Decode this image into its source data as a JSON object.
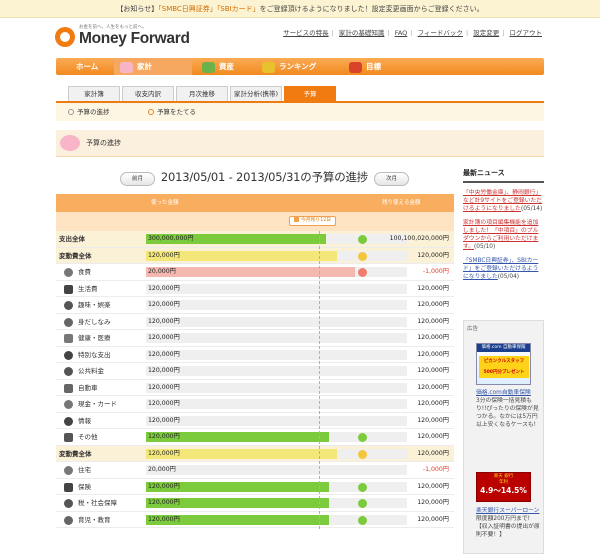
{
  "notice": {
    "prefix": "【お知らせ】",
    "b1": "「SMBC日興証券」",
    "b2": "「SBIカード」",
    "rest": "をご登録頂けるようになりました！設定変更画面からご登録ください。"
  },
  "brand": {
    "tagline": "お金を前へ。人生をもっと前へ。",
    "name": "Money Forward",
    "accent": "#f07b10"
  },
  "toplinks": [
    "サービスの特長",
    "家計の基礎知識",
    "FAQ",
    "フィードバック",
    "設定変更",
    "ログアウト"
  ],
  "gnav": [
    {
      "label": "ホーム",
      "icon": "home-icon"
    },
    {
      "label": "家計",
      "icon": "piggy-bank-icon"
    },
    {
      "label": "資産",
      "icon": "globe-icon"
    },
    {
      "label": "ランキング",
      "icon": "trophy-icon"
    },
    {
      "label": "目標",
      "icon": "goal-icon"
    }
  ],
  "subnav": [
    "家計簿",
    "収支内訳",
    "月次推移",
    "家計分析(携帯)",
    "予算"
  ],
  "subsub": [
    "予算の進捗",
    "予算をたてる"
  ],
  "section_title": "予算の進捗",
  "period": {
    "prev": "前月",
    "title": "2013/05/01 - 2013/05/31の予算の進捗",
    "next": "次月"
  },
  "table_head": {
    "used": "使った金額",
    "remaining": "残り使える金額",
    "today": "今月残り12日"
  },
  "rows": [
    {
      "label": "支出全体",
      "group": true,
      "used": "300,000,000円",
      "ratio": 0.69,
      "color": "#7ccb3c",
      "status": "good",
      "rem": "100,100,020,000円"
    },
    {
      "label": "変動費全体",
      "group": true,
      "used": "120,000円",
      "ratio": 0.73,
      "color": "#f3e77a",
      "status": "warn",
      "rem": "120,000円"
    },
    {
      "label": "食費",
      "icon": "food-icon",
      "used": "20,000円",
      "ratio": 0.8,
      "color": "#f5b8b0",
      "status": "bad",
      "rem": "-1,000円",
      "neg": true
    },
    {
      "label": "生活費",
      "icon": "smiley-icon",
      "used": "120,000円",
      "ratio": 0,
      "rem": "120,000円"
    },
    {
      "label": "趣味・娯楽",
      "icon": "star-icon",
      "used": "120,000円",
      "ratio": 0,
      "rem": "120,000円"
    },
    {
      "label": "身だしなみ",
      "icon": "shirt-icon",
      "used": "120,000円",
      "ratio": 0,
      "rem": "120,000円"
    },
    {
      "label": "健康・医療",
      "icon": "medical-icon",
      "used": "120,000円",
      "ratio": 0,
      "rem": "120,000円"
    },
    {
      "label": "特別な支出",
      "icon": "gift-icon",
      "used": "120,000円",
      "ratio": 0,
      "rem": "120,000円"
    },
    {
      "label": "公共料金",
      "icon": "bulb-icon",
      "used": "120,000円",
      "ratio": 0,
      "rem": "120,000円"
    },
    {
      "label": "自動車",
      "icon": "car-icon",
      "used": "120,000円",
      "ratio": 0,
      "rem": "120,000円"
    },
    {
      "label": "現金・カード",
      "icon": "card-icon",
      "used": "120,000円",
      "ratio": 0,
      "rem": "120,000円"
    },
    {
      "label": "情報",
      "icon": "info-icon",
      "used": "120,000円",
      "ratio": 0,
      "rem": "120,000円"
    },
    {
      "label": "その他",
      "icon": "other-icon",
      "used": "120,000円",
      "ratio": 0.7,
      "color": "#7ccb3c",
      "status": "good",
      "rem": "120,000円"
    },
    {
      "label": "変動費全体",
      "group": true,
      "used": "120,000円",
      "ratio": 0.73,
      "color": "#f3e77a",
      "status": "warn",
      "rem": "120,000円"
    },
    {
      "label": "住宅",
      "icon": "house-icon",
      "used": "20,000円",
      "ratio": 0,
      "rem": "-1,000円",
      "neg": true
    },
    {
      "label": "保険",
      "icon": "umbrella-icon",
      "used": "120,000円",
      "ratio": 0.7,
      "color": "#7ccb3c",
      "status": "good",
      "rem": "120,000円"
    },
    {
      "label": "税・社会保障",
      "icon": "tax-icon",
      "used": "120,000円",
      "ratio": 0.7,
      "color": "#7ccb3c",
      "status": "good",
      "rem": "120,000円"
    },
    {
      "label": "育児・教育",
      "icon": "pencil-icon",
      "used": "120,000円",
      "ratio": 0.7,
      "color": "#7ccb3c",
      "status": "good",
      "rem": "120,000円"
    }
  ],
  "status_colors": {
    "good": "#7ccb3c",
    "warn": "#f3c63c",
    "bad": "#f07b6e"
  },
  "sidebar": {
    "title": "最新ニュース",
    "news": [
      {
        "link": "「中央労働金庫」、静岡銀行」など計9サイトをご登録いただけるようになりました",
        "date": "(05/14)",
        "red": true
      },
      {
        "link": "家計簿の項目編集機能を追加しました！「中項目」のプルダウンからご利用いただけます。",
        "date": "(05/10)",
        "red": false
      },
      {
        "link": "「SMBC日興証券」、SBIカード」をご登録いただけるようになりました",
        "date": "(05/04)",
        "red": false
      }
    ],
    "ad_label": "広告",
    "ad1": {
      "top": "価格.com 自動車保険",
      "mid": "ピカンクルスタッフ",
      "bottom": "500円分プレゼント"
    },
    "ad1_link": "価格.com自動車保険",
    "ad1_text": "3分の保険一括見積もり!!ぴったりの保険が見つかる。なかには5万円以上安くなるケースも!",
    "ad2": {
      "top": "楽天 銀行",
      "mid": "年利",
      "rate": "4.9〜14.5%"
    },
    "ad2_link": "楽天銀行スーパーローン",
    "ad2_text": "限度額200万円まで!【収入証明書の提出が原則不要！】"
  }
}
